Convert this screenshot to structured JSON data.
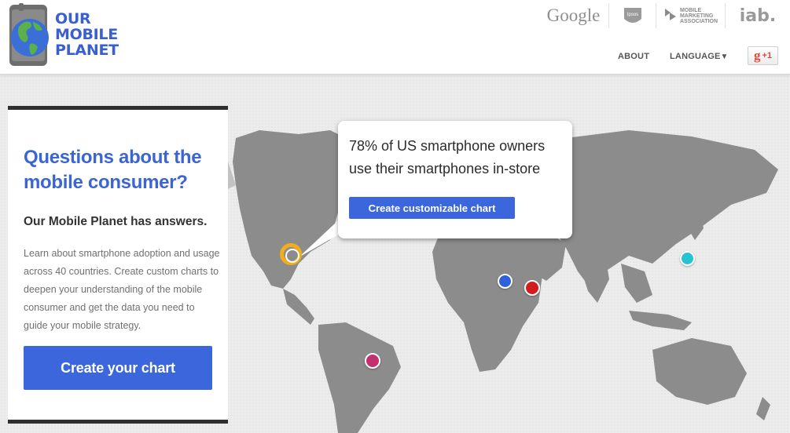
{
  "header": {
    "logo_lines": [
      "OUR",
      "MOBILE",
      "PLANET"
    ],
    "partners": {
      "google": "Google",
      "ipsos": "Ipsos",
      "mma": [
        "MOBILE",
        "MARKETING",
        "ASSOCIATION"
      ],
      "iab": "iab."
    },
    "nav": {
      "about": "ABOUT",
      "language": "LANGUAGE",
      "language_arrow": "▼"
    },
    "gplus": {
      "g": "g",
      "plus": "+1"
    }
  },
  "panel": {
    "title": "Questions about the mobile consumer?",
    "subtitle": "Our Mobile Planet has answers.",
    "body": "Learn about smartphone adoption and usage across 40 countries. Create custom charts to deepen your understanding of the mobile consumer and get the data you need to guide your mobile strategy.",
    "button": "Create your chart"
  },
  "callout": {
    "text": "78% of US smartphone owners use their smartphones in-store",
    "button": "Create customizable chart"
  },
  "colors": {
    "brand_blue": "#3b66dc",
    "marker_us": "#f1ad1c",
    "marker_blue": "#2f60de",
    "marker_red": "#d31c1c",
    "marker_cyan": "#27c3d3",
    "marker_magenta": "#c2306f",
    "map_land": "#8c8c8c"
  }
}
